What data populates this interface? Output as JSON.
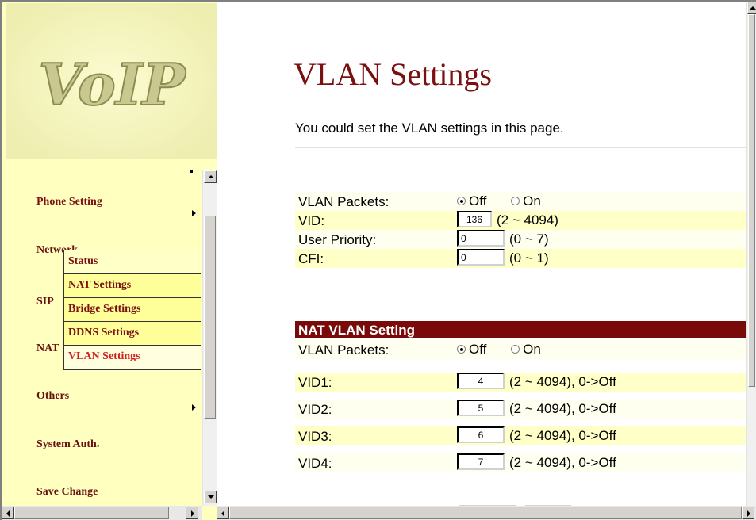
{
  "sidebar": {
    "logo_text": "VoIP",
    "nav": [
      {
        "label": "Phone Setting"
      },
      {
        "label": "Network"
      },
      {
        "label": "SIP"
      },
      {
        "label": "NAT"
      },
      {
        "label": "Others"
      },
      {
        "label": "System Auth."
      },
      {
        "label": "Save Change"
      }
    ],
    "submenu": [
      {
        "label": "Status"
      },
      {
        "label": "NAT Settings"
      },
      {
        "label": "Bridge Settings"
      },
      {
        "label": "DDNS Settings"
      },
      {
        "label": "VLAN Settings"
      }
    ]
  },
  "main": {
    "title": "VLAN Settings",
    "description": "You could set the VLAN settings in this page.",
    "vlan": {
      "packets_label": "VLAN Packets:",
      "off_label": "Off",
      "on_label": "On",
      "selected": "Off",
      "vid_label": "VID:",
      "vid_value": "136",
      "vid_range": "(2 ~ 4094)",
      "priority_label": "User Priority:",
      "priority_value": "0",
      "priority_range": "(0 ~ 7)",
      "cfi_label": "CFI:",
      "cfi_value": "0",
      "cfi_range": "(0 ~ 1)"
    },
    "nat_vlan": {
      "section_title": "NAT VLAN Setting",
      "packets_label": "VLAN Packets:",
      "off_label": "Off",
      "on_label": "On",
      "selected": "Off",
      "vid1_label": "VID1:",
      "vid1_value": "4",
      "vid2_label": "VID2:",
      "vid2_value": "5",
      "vid3_label": "VID3:",
      "vid3_value": "6",
      "vid4_label": "VID4:",
      "vid4_value": "7",
      "range": "(2 ~ 4094), 0->Off"
    }
  },
  "colors": {
    "sidebar_bg": "#ffffc0",
    "brand_red": "#7a1010",
    "section_bar": "#7a0a0a",
    "active_item": "#d02020"
  },
  "icons": [
    "submenu-arrow-icon",
    "scroll-up-icon",
    "scroll-down-icon",
    "scroll-left-icon",
    "scroll-right-icon"
  ]
}
